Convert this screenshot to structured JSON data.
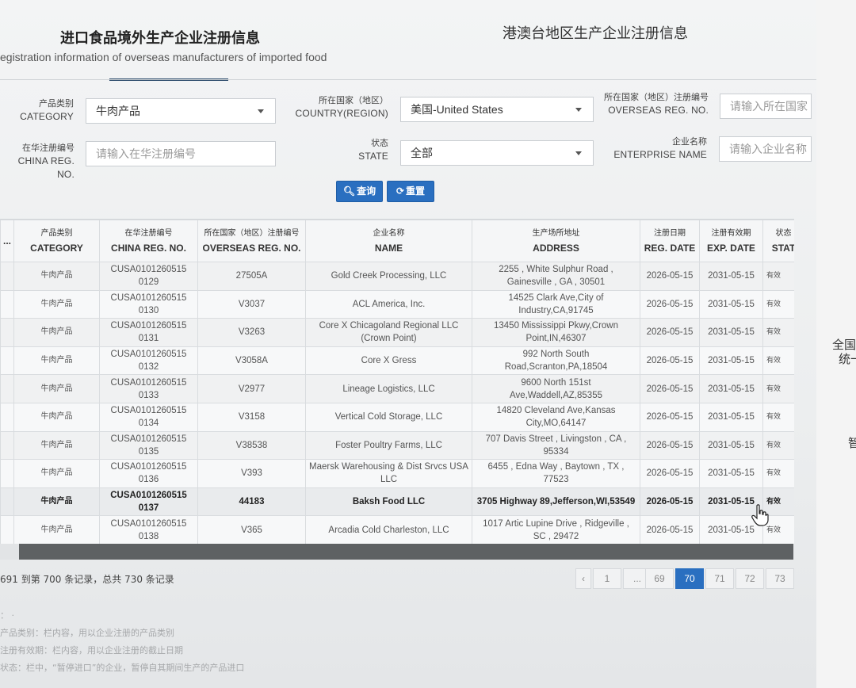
{
  "tabs": {
    "main_cn": "进口食品境外生产企业注册信息",
    "main_en": "egistration information of overseas manufacturers of imported food",
    "other_cn": "港澳台地区生产企业注册信息"
  },
  "filters": {
    "category": {
      "label_cn": "产品类别",
      "label_en": "CATEGORY",
      "value": "牛肉产品"
    },
    "country": {
      "label_cn": "所在国家（地区）",
      "label_en": "COUNTRY(REGION)",
      "value": "美国-United States"
    },
    "overseas_reg": {
      "label_cn": "所在国家（地区）注册编号",
      "label_en": "OVERSEAS REG. NO.",
      "placeholder": "请输入所在国家"
    },
    "china_reg": {
      "label_cn": "在华注册编号",
      "label_en": "CHINA REG. NO.",
      "placeholder": "请输入在华注册编号"
    },
    "state": {
      "label_cn": "状态",
      "label_en": "STATE",
      "value": "全部"
    },
    "enterprise": {
      "label_cn": "企业名称",
      "label_en": "ENTERPRISE NAME",
      "placeholder": "请输入企业名称"
    }
  },
  "buttons": {
    "query": "查询",
    "reset": "重置"
  },
  "table": {
    "headers": [
      {
        "cn": "",
        "en": "..."
      },
      {
        "cn": "产品类别",
        "en": "CATEGORY"
      },
      {
        "cn": "在华注册编号",
        "en": "CHINA REG. NO."
      },
      {
        "cn": "所在国家（地区）注册编号",
        "en": "OVERSEAS REG. NO."
      },
      {
        "cn": "企业名称",
        "en": "NAME"
      },
      {
        "cn": "生产场所地址",
        "en": "ADDRESS"
      },
      {
        "cn": "注册日期",
        "en": "REG. DATE"
      },
      {
        "cn": "注册有效期",
        "en": "EXP. DATE"
      },
      {
        "cn": "状态",
        "en": "STAT"
      }
    ],
    "rows": [
      {
        "category": "牛肉产品",
        "china_reg": "CUSA0101260515 0129",
        "overseas_reg": "27505A",
        "name": "Gold Creek Processing, LLC",
        "address": "2255 , White Sulphur Road , Gainesville , GA , 30501",
        "reg_date": "2026-05-15",
        "exp_date": "2031-05-15",
        "state": "有效"
      },
      {
        "category": "牛肉产品",
        "china_reg": "CUSA0101260515 0130",
        "overseas_reg": "V3037",
        "name": "ACL America, Inc.",
        "address": "14525 Clark Ave,City of Industry,CA,91745",
        "reg_date": "2026-05-15",
        "exp_date": "2031-05-15",
        "state": "有效"
      },
      {
        "category": "牛肉产品",
        "china_reg": "CUSA0101260515 0131",
        "overseas_reg": "V3263",
        "name": "Core X Chicagoland Regional LLC (Crown Point)",
        "address": "13450 Mississippi Pkwy,Crown Point,IN,46307",
        "reg_date": "2026-05-15",
        "exp_date": "2031-05-15",
        "state": "有效"
      },
      {
        "category": "牛肉产品",
        "china_reg": "CUSA0101260515 0132",
        "overseas_reg": "V3058A",
        "name": "Core X Gress",
        "address": "992 North South Road,Scranton,PA,18504",
        "reg_date": "2026-05-15",
        "exp_date": "2031-05-15",
        "state": "有效"
      },
      {
        "category": "牛肉产品",
        "china_reg": "CUSA0101260515 0133",
        "overseas_reg": "V2977",
        "name": "Lineage Logistics, LLC",
        "address": "9600 North 151st Ave,Waddell,AZ,85355",
        "reg_date": "2026-05-15",
        "exp_date": "2031-05-15",
        "state": "有效"
      },
      {
        "category": "牛肉产品",
        "china_reg": "CUSA0101260515 0134",
        "overseas_reg": "V3158",
        "name": "Vertical Cold Storage, LLC",
        "address": "14820 Cleveland Ave,Kansas City,MO,64147",
        "reg_date": "2026-05-15",
        "exp_date": "2031-05-15",
        "state": "有效"
      },
      {
        "category": "牛肉产品",
        "china_reg": "CUSA0101260515 0135",
        "overseas_reg": "V38538",
        "name": "Foster Poultry Farms, LLC",
        "address": "707 Davis Street , Livingston , CA , 95334",
        "reg_date": "2026-05-15",
        "exp_date": "2031-05-15",
        "state": "有效"
      },
      {
        "category": "牛肉产品",
        "china_reg": "CUSA0101260515 0136",
        "overseas_reg": "V393",
        "name": "Maersk Warehousing & Dist Srvcs USA LLC",
        "address": "6455 , Edna Way , Baytown , TX , 77523",
        "reg_date": "2026-05-15",
        "exp_date": "2031-05-15",
        "state": "有效"
      },
      {
        "category": "牛肉产品",
        "china_reg": "CUSA0101260515 0137",
        "overseas_reg": "44183",
        "name": "Baksh Food LLC",
        "address": "3705 Highway 89,Jefferson,WI,53549",
        "reg_date": "2026-05-15",
        "exp_date": "2031-05-15",
        "state": "有效"
      },
      {
        "category": "牛肉产品",
        "china_reg": "CUSA0101260515 0138",
        "overseas_reg": "V365",
        "name": "Arcadia Cold Charleston, LLC",
        "address": "1017 Artic Lupine Drive , Ridgeville , SC , 29472",
        "reg_date": "2026-05-15",
        "exp_date": "2031-05-15",
        "state": "有效"
      }
    ]
  },
  "summary": "691 到第 700 条记录，总共 730 条记录",
  "pagination": [
    "‹",
    "1",
    "...",
    "69",
    "70",
    "71",
    "72",
    "73"
  ],
  "pagination_active": "70",
  "notes": [
    "：   ·",
    "产品类别：栏内容，用以企业注册的产品类别",
    "注册有效期：栏内容，用以企业注册的截止日期",
    "状态：栏中，“暂停进口”的企业，暂停自其期间生产的产品进口"
  ],
  "side_text": [
    "全国",
    "统一",
    "智"
  ],
  "colors": {
    "accent": "#2a6fc0",
    "scrollbar": "#5e6163"
  }
}
